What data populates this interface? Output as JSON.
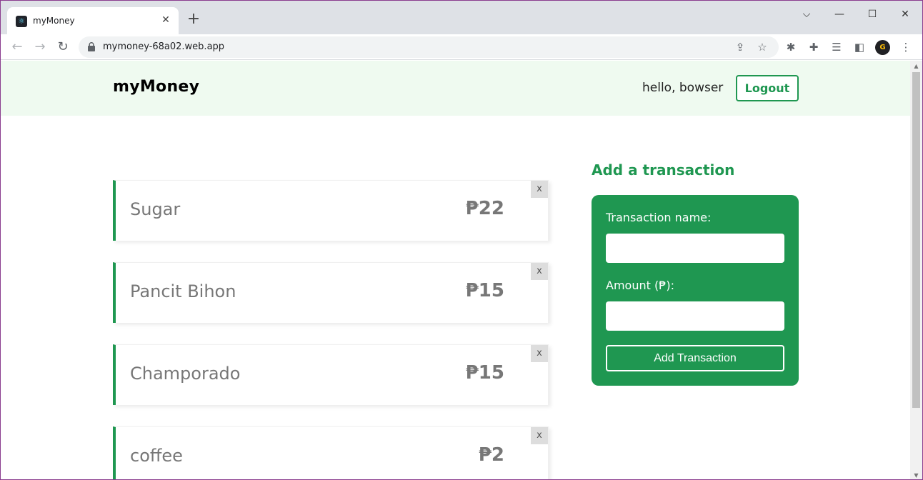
{
  "browser": {
    "tab_title": "myMoney",
    "tab_close": "✕",
    "new_tab": "+",
    "url": "mymoney-68a02.web.app",
    "controls": {
      "tab_search": "⌵",
      "minimize": "—",
      "maximize": "☐",
      "close": "✕"
    },
    "nav": {
      "back": "←",
      "forward": "→",
      "reload": "↻"
    },
    "toolbar_icons": [
      "share-icon",
      "bookmark-star-icon",
      "bug-extension-icon",
      "puzzle-extensions-icon",
      "reading-list-icon",
      "side-panel-icon",
      "profile-avatar",
      "kebab-menu-icon"
    ],
    "profile_initial": "G"
  },
  "app": {
    "brand": "myMoney",
    "greeting": "hello, bowser",
    "logout_label": "Logout",
    "accent_color": "#1f9751",
    "navbar_bg": "#effaf0"
  },
  "transactions": [
    {
      "name": "Sugar",
      "amount": "₱22",
      "delete": "x"
    },
    {
      "name": "Pancit Bihon",
      "amount": "₱15",
      "delete": "x"
    },
    {
      "name": "Champorado",
      "amount": "₱15",
      "delete": "x"
    },
    {
      "name": "coffee",
      "amount": "₱2",
      "delete": "x"
    }
  ],
  "form": {
    "title": "Add a transaction",
    "name_label": "Transaction name:",
    "name_value": "",
    "amount_label": "Amount (₱):",
    "amount_value": "",
    "submit_label": "Add Transaction"
  }
}
